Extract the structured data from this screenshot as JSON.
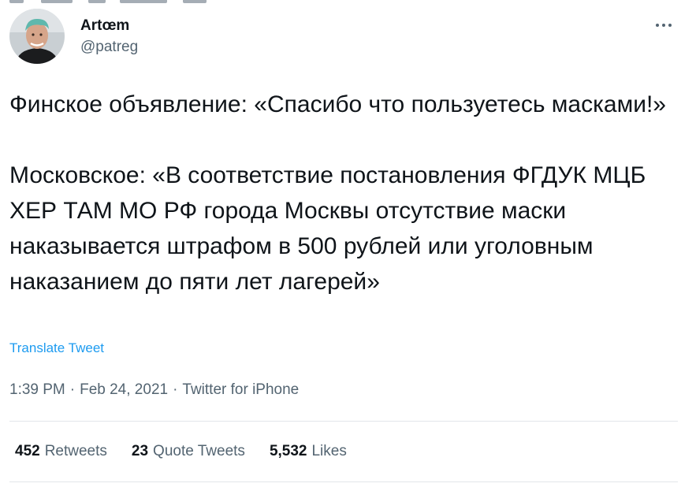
{
  "colors": {
    "text_primary": "#0f1419",
    "text_secondary": "#536471",
    "link": "#1d9bf0",
    "divider": "#e2e6ea"
  },
  "author": {
    "display_name": "Artœm",
    "handle": "@patreg",
    "avatar_icon": "profile-photo"
  },
  "more_icon": "ellipsis-icon",
  "tweet": {
    "paragraph_1": "Финское объявление: «Спасибо что пользуетесь масками!»",
    "paragraph_2": "Московское: «В соответствие постановления ФГДУК МЦБ ХЕР ТАМ МО РФ города Москвы отсутствие маски наказывается штрафом в 500 рублей или уголовным наказанием до пяти лет лагерей»"
  },
  "translate_label": "Translate Tweet",
  "meta": {
    "time": "1:39 PM",
    "separator": "·",
    "date": "Feb 24, 2021",
    "source": "Twitter for iPhone"
  },
  "stats": {
    "retweets": {
      "count": "452",
      "label": "Retweets"
    },
    "quote_tweets": {
      "count": "23",
      "label": "Quote Tweets"
    },
    "likes": {
      "count": "5,532",
      "label": "Likes"
    }
  }
}
